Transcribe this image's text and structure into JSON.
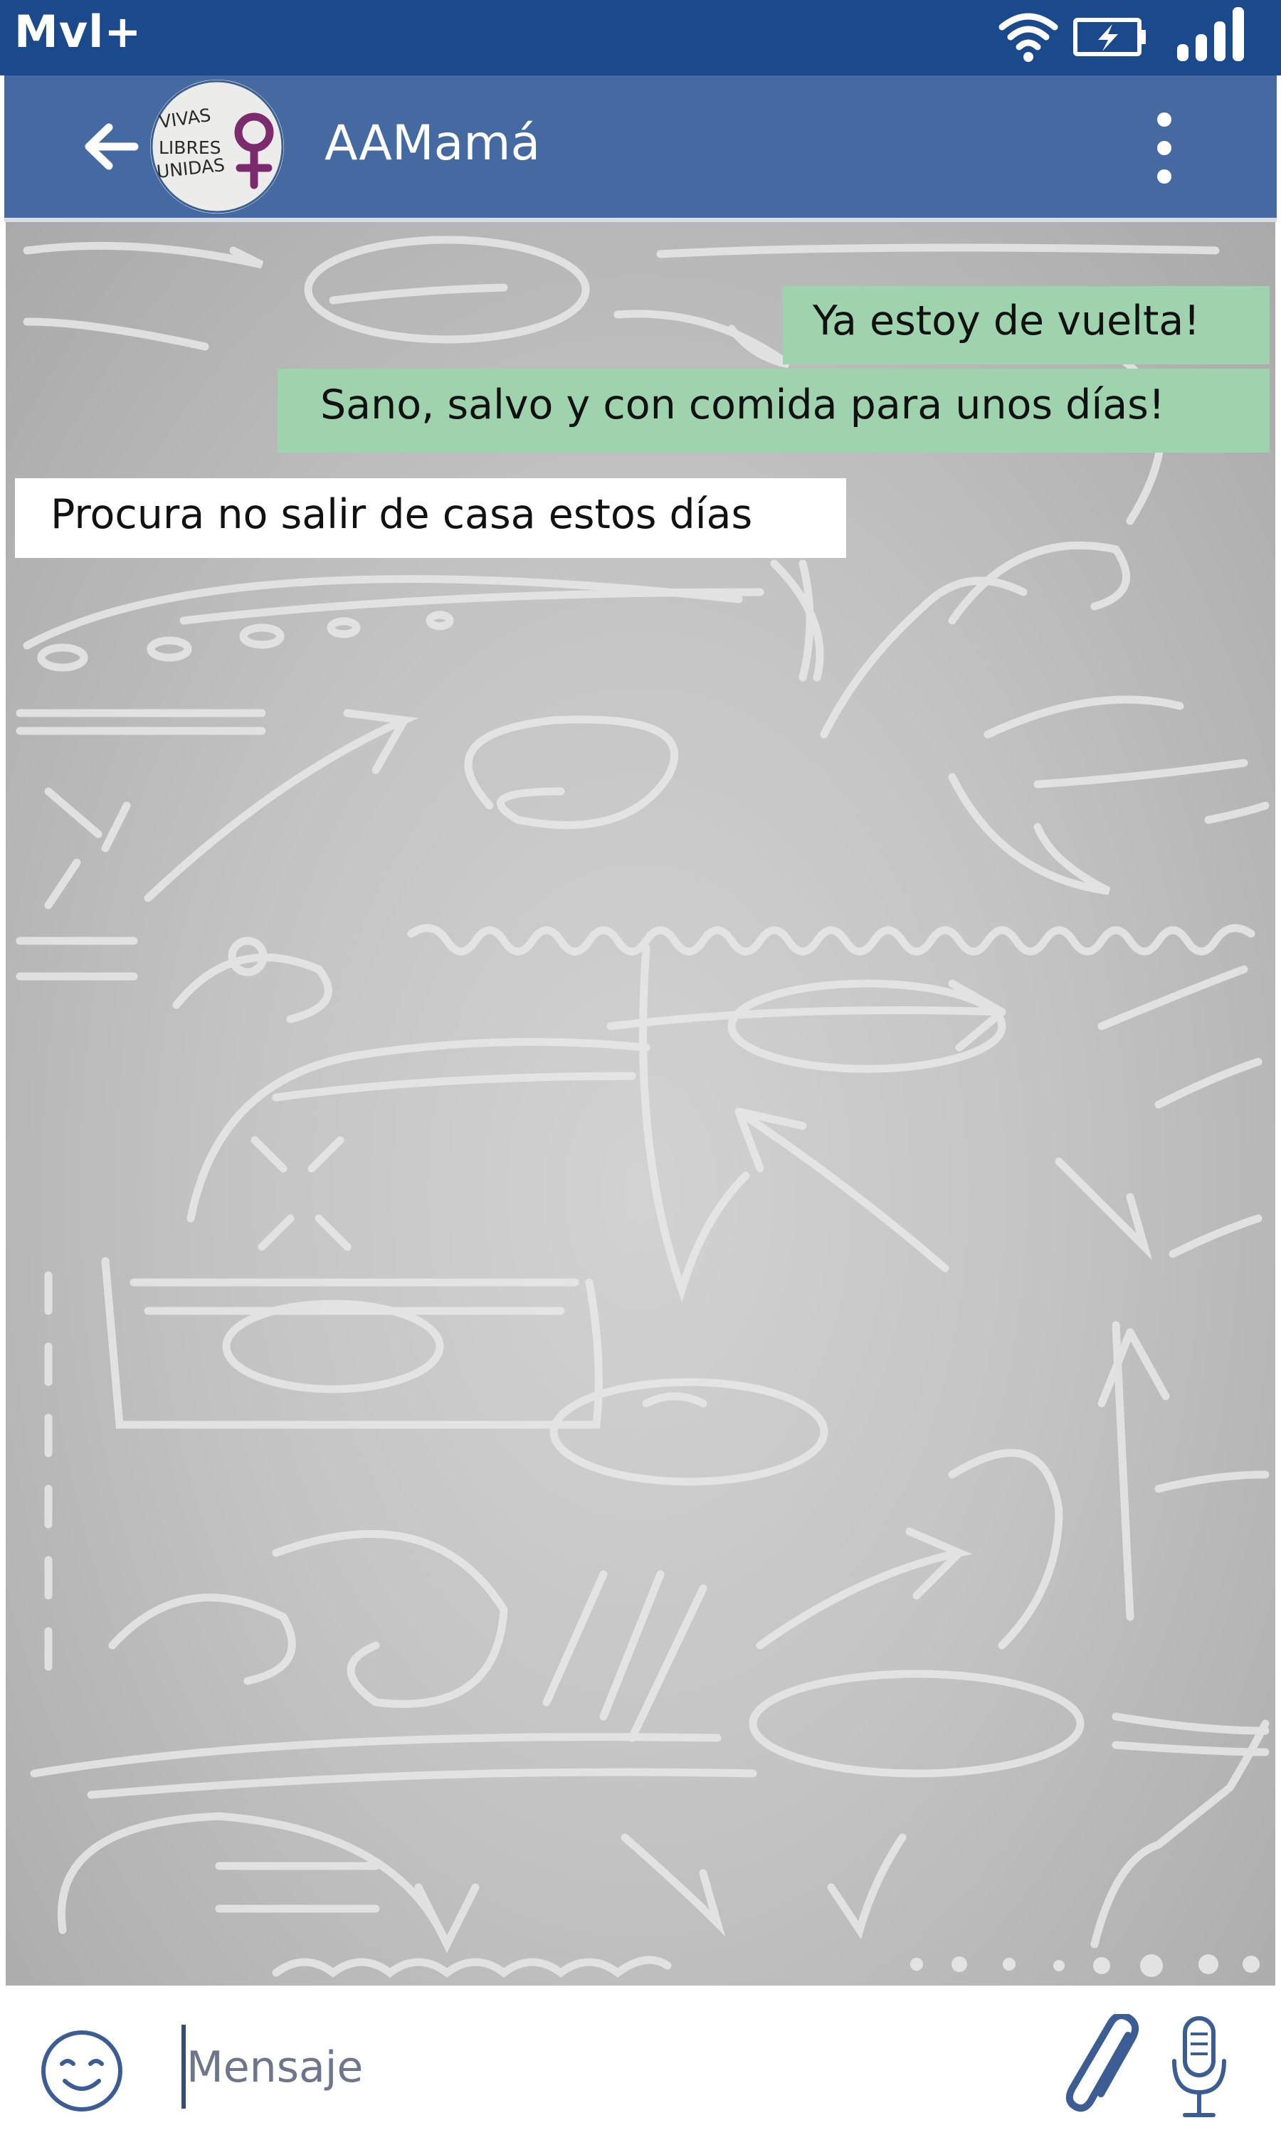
{
  "status_bar": {
    "carrier": "Mvl+",
    "icons": [
      "wifi-icon",
      "battery-charging-icon",
      "signal-icon"
    ]
  },
  "header": {
    "title": "AAMamá",
    "avatar_text": [
      "VIVAS",
      "LIBRES",
      "UNIDAS"
    ],
    "icons": [
      "back-arrow-icon",
      "avatar",
      "more-vert-icon"
    ]
  },
  "messages": [
    {
      "direction": "outgoing",
      "text": "Ya estoy de vuelta!"
    },
    {
      "direction": "outgoing",
      "text": "Sano, salvo y con comida para unos días!"
    },
    {
      "direction": "incoming",
      "text": "Procura no salir de casa estos días"
    }
  ],
  "composer": {
    "placeholder": "Mensaje",
    "value": "",
    "icons": [
      "emoji-icon",
      "attach-icon",
      "mic-icon"
    ]
  },
  "colors": {
    "status_bar": "#1b4a8c",
    "header": "#456aa2",
    "outgoing_bubble": "#9fd3ae",
    "incoming_bubble": "#ffffff",
    "chat_background": "#c4c4c4",
    "avatar_symbol": "#7b2b6e"
  }
}
